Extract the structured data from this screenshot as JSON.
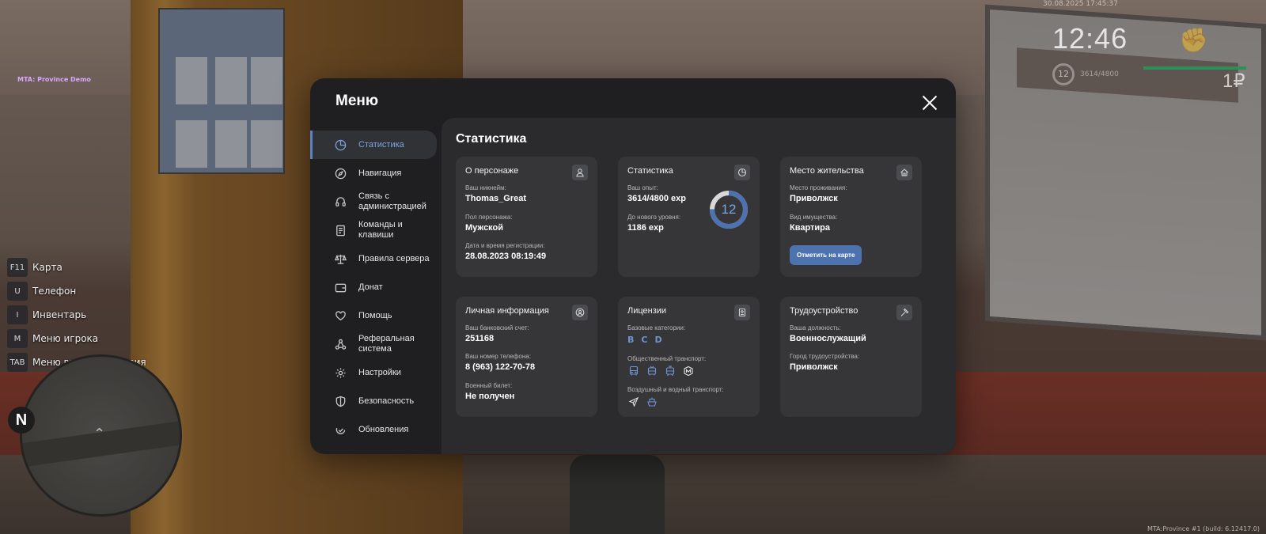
{
  "hud": {
    "server_tag": "MTA: Province Demo",
    "datetime": "30.08.2025 17:45:37",
    "clock": "12:46",
    "level": "12",
    "exp": "3614/4800",
    "money": "1₽",
    "build_info": "MTA:Province #1 (build: 6.12417.0)",
    "compass": "N"
  },
  "hotkeys": [
    {
      "key": "F11",
      "label": "Карта"
    },
    {
      "key": "U",
      "label": "Телефон"
    },
    {
      "key": "I",
      "label": "Инвентарь"
    },
    {
      "key": "M",
      "label": "Меню игрока"
    },
    {
      "key": "TAB",
      "label": "Меню взаимодействия"
    }
  ],
  "menu": {
    "title": "Меню",
    "close_icon": "close-icon",
    "nav": [
      {
        "label": "Статистика",
        "icon": "pie-chart-icon",
        "active": true
      },
      {
        "label": "Навигация",
        "icon": "compass-icon"
      },
      {
        "label": "Связь с администрацией",
        "icon": "headset-icon"
      },
      {
        "label": "Команды и клавиши",
        "icon": "document-icon"
      },
      {
        "label": "Правила сервера",
        "icon": "scales-icon"
      },
      {
        "label": "Донат",
        "icon": "wallet-icon"
      },
      {
        "label": "Помощь",
        "icon": "heart-hand-icon"
      },
      {
        "label": "Реферальная система",
        "icon": "referral-icon"
      },
      {
        "label": "Настройки",
        "icon": "gear-icon"
      },
      {
        "label": "Безопасность",
        "icon": "shield-icon"
      },
      {
        "label": "Обновления",
        "icon": "refresh-check-icon"
      }
    ]
  },
  "page": {
    "title": "Статистика",
    "about": {
      "title": "О персонаже",
      "nickname_label": "Ваш никнейм:",
      "nickname": "Thomas_Great",
      "gender_label": "Пол персонажа:",
      "gender": "Мужской",
      "reg_label": "Дата и время регистрации:",
      "reg": "28.08.2023 08:19:49"
    },
    "stats": {
      "title": "Статистика",
      "exp_label": "Ваш опыт:",
      "exp": "3614/4800 exp",
      "next_label": "До нового уровня:",
      "next": "1186 exp",
      "level": "12",
      "level_progress": 0.753
    },
    "residence": {
      "title": "Место жительства",
      "place_label": "Место проживания:",
      "place": "Приволжск",
      "property_label": "Вид имущества:",
      "property": "Квартира",
      "button": "Отметить на карте"
    },
    "personal": {
      "title": "Личная информация",
      "bank_label": "Ваш банковский счет:",
      "bank": "251168",
      "phone_label": "Ваш номер телефона:",
      "phone": "8 (963) 122-70-78",
      "military_label": "Военный билет:",
      "military": "Не получен"
    },
    "licenses": {
      "title": "Лицензии",
      "base_label": "Базовые категории:",
      "base": [
        "B",
        "C",
        "D"
      ],
      "public_label": "Общественный транспорт:",
      "air_label": "Воздушный и водный транспорт:"
    },
    "employment": {
      "title": "Трудоустройство",
      "position_label": "Ваша должность:",
      "position": "Военнослужащий",
      "city_label": "Город трудоустройства:",
      "city": "Приволжск"
    }
  },
  "colors": {
    "accent": "#5b84c4",
    "accent_text": "#7ea3e0",
    "modal_bg": "#1f1f21",
    "content_bg": "#2b2b2d",
    "card_bg": "#363638"
  }
}
